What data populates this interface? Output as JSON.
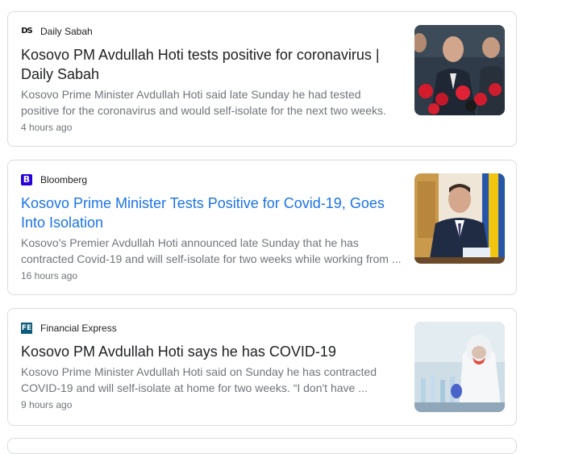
{
  "articles": [
    {
      "source": "Daily Sabah",
      "logo_text": "DS",
      "logo_icon": "daily-sabah-logo-icon",
      "title": "Kosovo PM Avdullah Hoti tests positive for coronavirus | Daily Sabah",
      "snippet_line1": "Kosovo Prime Minister Avdullah Hoti said late Sunday he had tested",
      "snippet_line2": "positive for the coronavirus and would self-isolate for the next two weeks.",
      "time": "4 hours ago"
    },
    {
      "source": "Bloomberg",
      "logo_text": "B",
      "logo_icon": "bloomberg-logo-icon",
      "logo_color": "#2800d7",
      "title": "Kosovo Prime Minister Tests Positive for Covid-19, Goes Into Isolation",
      "snippet_line1": "Kosovo's Premier Avdullah Hoti announced late Sunday that he has",
      "snippet_line2": "contracted Covid-19 and will self-isolate for two weeks while working from ...",
      "time": "16 hours ago"
    },
    {
      "source": "Financial Express",
      "logo_text": "FE",
      "logo_icon": "financial-express-logo-icon",
      "logo_color": "#0b5c7a",
      "title": "Kosovo PM Avdullah Hoti says he has COVID-19",
      "snippet_line1": "Kosovo Prime Minister Avdullah Hoti said on Sunday he has contracted",
      "snippet_line2": "COVID-19 and will self-isolate at home for two weeks. “I don't have ...",
      "time": "9 hours ago"
    }
  ],
  "colors": {
    "title_default": "#202124",
    "title_highlight": "#1a73e8",
    "meta": "#70757a",
    "border": "#dadce0"
  }
}
